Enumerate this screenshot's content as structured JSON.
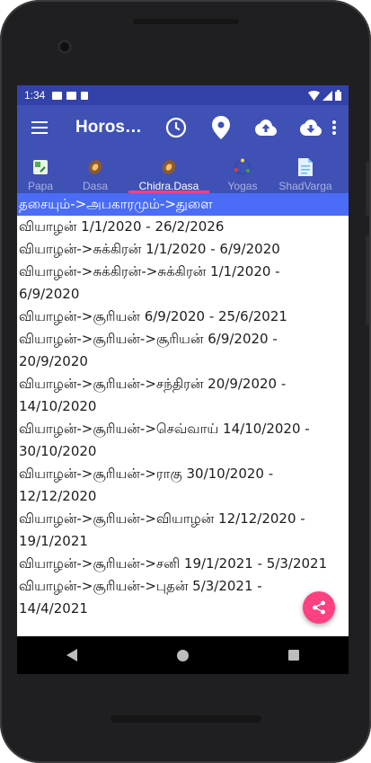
{
  "status_bar": {
    "time": "1:34",
    "icons": [
      "mail-icon",
      "a-notification-icon",
      "sd-card-icon",
      "wifi-icon",
      "signal-icon",
      "battery-icon"
    ]
  },
  "app_bar": {
    "title": "Horoscope",
    "actions": [
      "clock-icon",
      "location-pin-icon",
      "cloud-upload-icon",
      "cloud-download-icon",
      "overflow-menu-icon"
    ],
    "color": "#3f51b5"
  },
  "tabs": [
    {
      "label": "Papa",
      "icon": "papa-icon"
    },
    {
      "label": "Dasa",
      "icon": "dasa-icon"
    },
    {
      "label": "Chidra.Dasa",
      "icon": "chidra-dasa-icon",
      "active": true
    },
    {
      "label": "Yogas",
      "icon": "yogas-icon"
    },
    {
      "label": "ShadVarga",
      "icon": "shadvarga-icon"
    }
  ],
  "content": {
    "lines": [
      "தசையும்->அபகாரமும்->துளை",
      "வியாழன் 1/1/2020 - 26/2/2026",
      "வியாழன்->சுக்கிரன் 1/1/2020 - 6/9/2020",
      "வியாழன்->சுக்கிரன்->சுக்கிரன் 1/1/2020 -",
      "6/9/2020",
      "வியாழன்->சூரியன் 6/9/2020 - 25/6/2021",
      "வியாழன்->சூரியன்->சூரியன் 6/9/2020 -",
      "20/9/2020",
      "வியாழன்->சூரியன்->சந்திரன் 20/9/2020 -",
      "14/10/2020",
      "வியாழன்->சூரியன்->செவ்வாய் 14/10/2020 -",
      "30/10/2020",
      "வியாழன்->சூரியன்->ராகு 30/10/2020 -",
      "12/12/2020",
      "வியாழன்->சூரியன்->வியாழன் 12/12/2020 -",
      "19/1/2021",
      "வியாழன்->சூரியன்->சனி 19/1/2021 - 5/3/2021",
      "வியாழன்->சூரியன்->புதன் 5/3/2021 -",
      "14/4/2021"
    ],
    "highlight_color": "#4a6cf7"
  },
  "fab": {
    "icon": "share-icon",
    "color": "#ff4081"
  },
  "nav_bar": {
    "buttons": [
      "back-icon",
      "home-icon",
      "recents-icon"
    ]
  }
}
